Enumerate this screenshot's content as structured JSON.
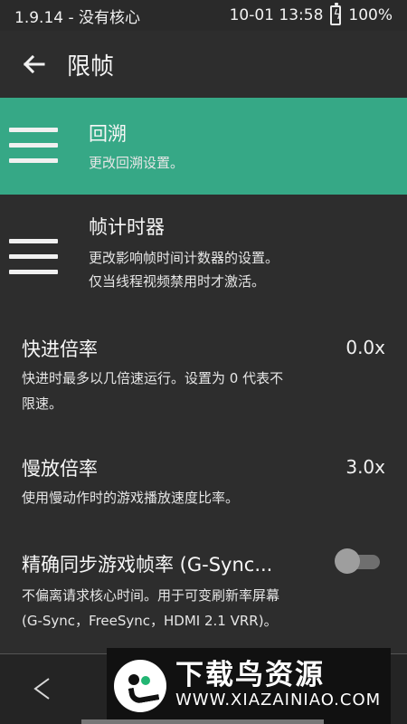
{
  "status": {
    "left_text": "1.9.14 - 没有核心",
    "time_text": "10-01 13:58",
    "battery_text": "100%"
  },
  "appbar": {
    "title": "限帧"
  },
  "menu_items": [
    {
      "title": "回溯",
      "subtitle": "更改回溯设置。",
      "selected": true
    },
    {
      "title": "帧计时器",
      "subtitle_line1": "更改影响帧时间计数器的设置。",
      "subtitle_line2": "仅当线程视频禁用时才激活。",
      "selected": false
    }
  ],
  "settings": {
    "fast_forward": {
      "title": "快进倍率",
      "value": "0.0x",
      "desc_line1": "快进时最多以几倍速运行。设置为 0 代表不",
      "desc_line2": "限速。"
    },
    "slow_motion": {
      "title": "慢放倍率",
      "value": "3.0x",
      "desc_line1": "使用慢动作时的游戏播放速度比率。"
    },
    "sync": {
      "title": "精确同步游戏帧率 (G-Sync...",
      "desc_line1": "不偏离请求核心时间。用于可变刷新率屏幕",
      "desc_line2": "(G-Sync，FreeSync，HDMI 2.1 VRR)。",
      "enabled": false
    }
  },
  "watermark": {
    "title": "下载鸟资源",
    "url": "WWW.XIAZAINIAO.COM"
  },
  "colors": {
    "accent": "#36a886",
    "background": "#2d2d2d"
  }
}
